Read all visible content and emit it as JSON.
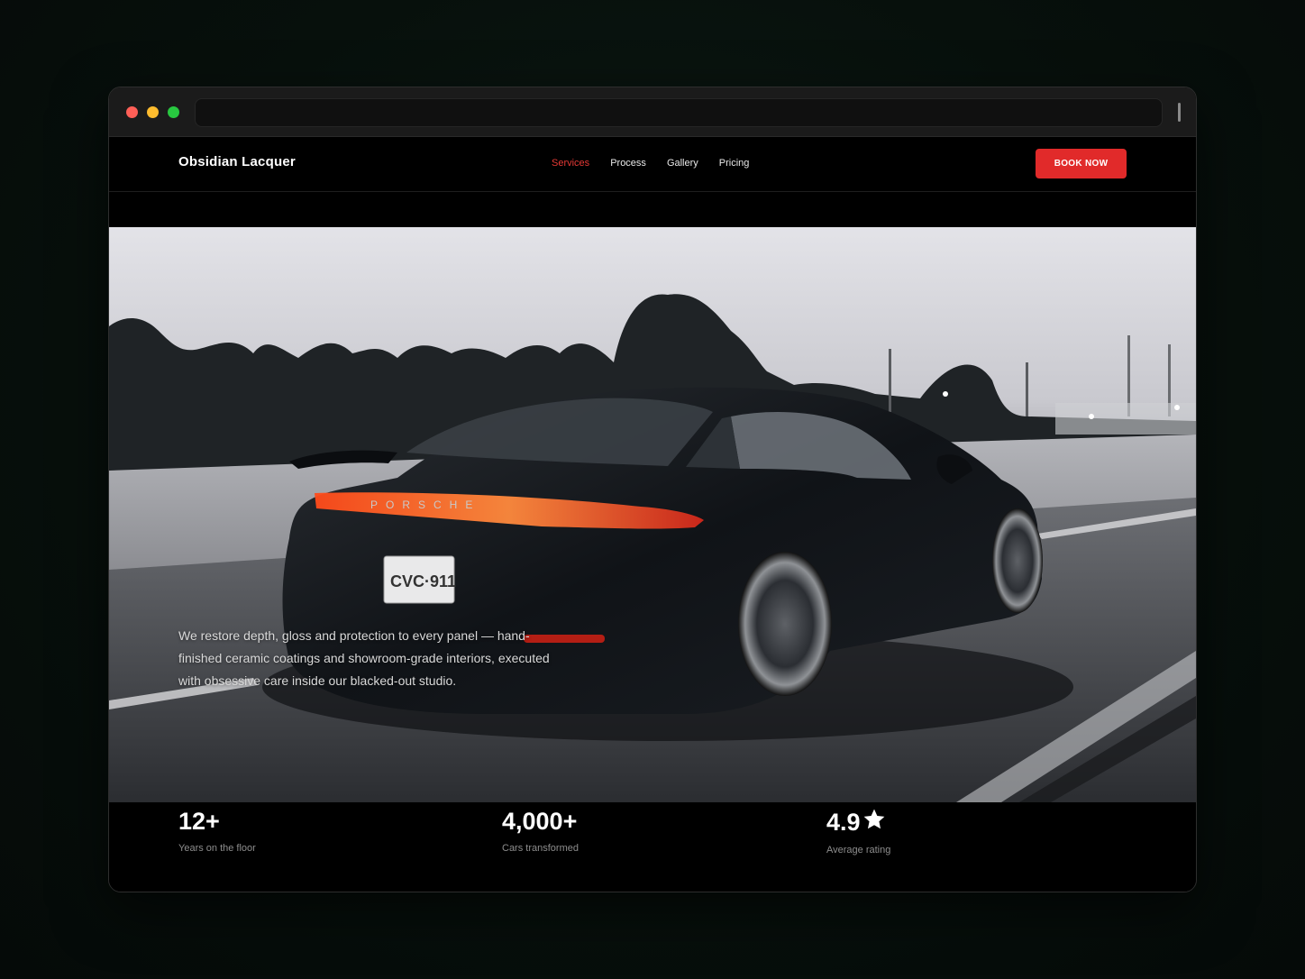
{
  "brand": {
    "name": "Obsidian Lacquer"
  },
  "nav": {
    "items": [
      {
        "label": "Services",
        "active": true
      },
      {
        "label": "Process",
        "active": false
      },
      {
        "label": "Gallery",
        "active": false
      },
      {
        "label": "Pricing",
        "active": false
      }
    ],
    "cta_label": "BOOK NOW"
  },
  "hero": {
    "description": "We restore depth, gloss and protection to every panel — hand-finished ceramic coatings and showroom-grade interiors, executed with obsessive care inside our blacked-out studio.",
    "image_icon": "sports-car-photo",
    "plate_text": "CVC·911",
    "car_badge": "PORSCHE"
  },
  "stats": [
    {
      "value": "12+",
      "label": "Years on the floor"
    },
    {
      "value": "4,000+",
      "label": "Cars transformed"
    },
    {
      "value": "4.9",
      "label": "Average rating",
      "icon": "star-icon"
    }
  ],
  "colors": {
    "accent": "#e12a2a",
    "nav_active": "#e53935",
    "background": "#000000"
  }
}
